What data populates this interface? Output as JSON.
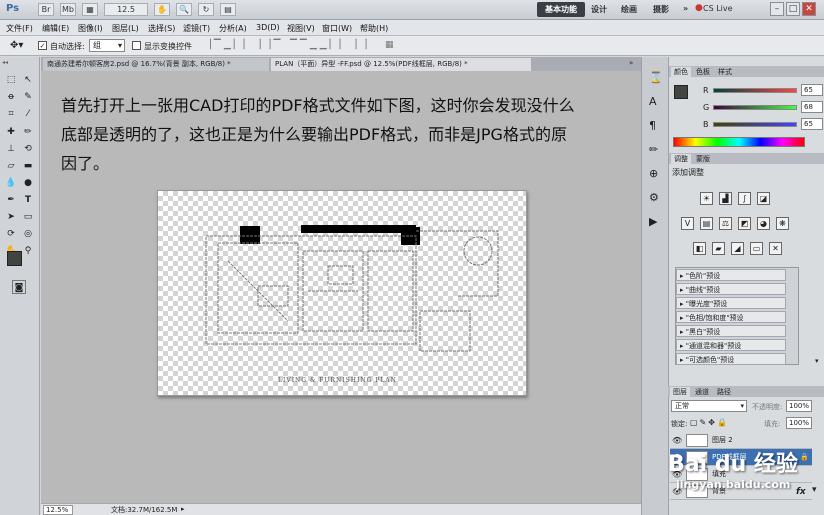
{
  "titlebar": {
    "logo": "Ps",
    "buttons": [
      "Br",
      "Mb",
      "12.5"
    ],
    "workspace_active": "基本功能",
    "workspaces": [
      "设计",
      "绘画",
      "摄影"
    ],
    "more": "»",
    "cslive": "CS Live",
    "window_controls": [
      "–",
      "□",
      "✕"
    ]
  },
  "menubar": {
    "items": [
      "文件(F)",
      "编辑(E)",
      "图像(I)",
      "图层(L)",
      "选择(S)",
      "滤镜(T)",
      "分析(A)",
      "3D(D)",
      "视图(V)",
      "窗口(W)",
      "帮助(H)"
    ]
  },
  "options": {
    "auto_select_label": "自动选择:",
    "auto_select_value": "组",
    "show_transform_label": "显示变换控件"
  },
  "tabs": [
    {
      "label": "南通苏建希尔顿客房2.psd @ 16.7%(背景 副本, RGB/8) *"
    },
    {
      "label": "PLAN（平面）异型 -FF.psd @ 12.5%(PDF线框层, RGB/8) *"
    }
  ],
  "instruction": {
    "lines": [
      "首先打开上一张用CAD打印的PDF格式文件如下图，这时你会发现没什么",
      "底部是透明的了，这也正是为什么要输出PDF格式，而非是JPG格式的原",
      "因了。"
    ]
  },
  "document": {
    "plan_caption": "LIVING & FURNISHING PLAN"
  },
  "status": {
    "zoom": "12.5%",
    "doc_size": "文档:32.7M/162.5M"
  },
  "color_panel": {
    "tabs": [
      "颜色",
      "色板",
      "样式"
    ],
    "channels": [
      {
        "label": "R",
        "value": "65"
      },
      {
        "label": "G",
        "value": "68"
      },
      {
        "label": "B",
        "value": "65"
      }
    ],
    "fg_color": "#414441"
  },
  "adjust_panel": {
    "tabs": [
      "调整",
      "蒙版"
    ],
    "title": "添加调整",
    "presets": [
      "\"色阶\"预设",
      "\"曲线\"预设",
      "\"曝光度\"预设",
      "\"色相/饱和度\"预设",
      "\"黑白\"预设",
      "\"通道混和器\"预设",
      "\"可选颜色\"预设"
    ]
  },
  "layers_panel": {
    "tabs": [
      "图层",
      "通道",
      "路径"
    ],
    "blend_mode": "正常",
    "opacity_label": "不透明度:",
    "opacity": "100%",
    "lock_label": "锁定:",
    "fill_label": "填充:",
    "fill": "100%",
    "layers": [
      {
        "name": "图层 2"
      },
      {
        "name": "PDF线框层"
      },
      {
        "name": "填充"
      },
      {
        "name": "背景"
      }
    ]
  },
  "watermark": {
    "brand": "Bai du 经验",
    "url": "jingyan.baidu.com"
  }
}
